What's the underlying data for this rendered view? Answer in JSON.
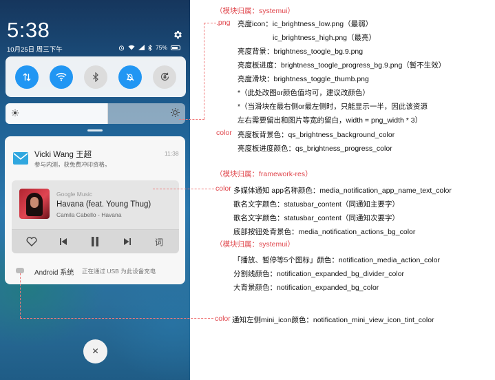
{
  "phone": {
    "status": {
      "time": "5:38",
      "date": "10月25日 周三下午",
      "battery": "75%",
      "icons": [
        "alarm-icon",
        "wifi-icon",
        "signal-icon",
        "bluetooth-icon",
        "battery-icon"
      ]
    },
    "quick_settings": [
      {
        "name": "data",
        "icon": "data-transfer-icon",
        "state": "on"
      },
      {
        "name": "wifi",
        "icon": "wifi-icon",
        "state": "on"
      },
      {
        "name": "bluetooth",
        "icon": "bluetooth-icon",
        "state": "off"
      },
      {
        "name": "silent",
        "icon": "bell-off-icon",
        "state": "on"
      },
      {
        "name": "rotation",
        "icon": "rotation-lock-icon",
        "state": "off"
      }
    ],
    "brightness": {
      "level": 0.57
    },
    "notification": {
      "sender": "Vicki Wang 王超",
      "message": "参与内测，获免费冲印资格。",
      "time": "11:38"
    },
    "media": {
      "app": "Google Music",
      "title": "Havana (feat. Young Thug)",
      "artist": "Camila Cabello - Havana",
      "actions": [
        "heart-icon",
        "previous-icon",
        "pause-icon",
        "next-icon",
        "lyrics-icon"
      ],
      "lyrics_label": "词"
    },
    "system": {
      "app": "Android 系统",
      "message": "正在通过 USB 为此设备充电"
    },
    "close_label": "×"
  },
  "annotations": {
    "module1": "（模块归属：systemui）",
    "png_tag": ".png",
    "lines1": [
      "亮度icon：ic_brightness_low.png（最弱）",
      "ic_brightness_high.png（最亮）",
      "亮度背景：brightness_toogle_bg.9.png",
      "亮度板进度：brightness_toogle_progress_bg.9.png（暂不生效）",
      "亮度滑块：brightness_toggle_thumb.png",
      "*（此处改图or颜色值均可，建议改颜色）",
      "*（当滑块在最右侧or最左侧时，只能显示一半，因此该资源",
      "左右需要留出和图片等宽的留白，width = png_width * 3）"
    ],
    "color_tag": "color",
    "lines2": [
      "亮度板背景色：qs_brightness_background_color",
      "亮度板进度颜色：qs_brightness_progress_color"
    ],
    "module2": "（模块归属：framework-res）",
    "lines3": [
      "多媒体通知 app名称颜色：media_notification_app_name_text_color",
      "歌名文字颜色：statusbar_content（同通知主要字）",
      "歌名文字颜色：statusbar_content（同通知次要字）",
      "底部按钮处背景色：media_notification_actions_bg_color"
    ],
    "module3": "（模块归属：systemui）",
    "lines4": [
      "「播放、暂停等5个图标」颜色：notification_media_action_color",
      "分割线颜色：notification_expanded_bg_divider_color",
      "大背景颜色：notification_expanded_bg_color"
    ],
    "line5": "通知左侧mini_icon颜色：notification_mini_view_icon_tint_color"
  }
}
